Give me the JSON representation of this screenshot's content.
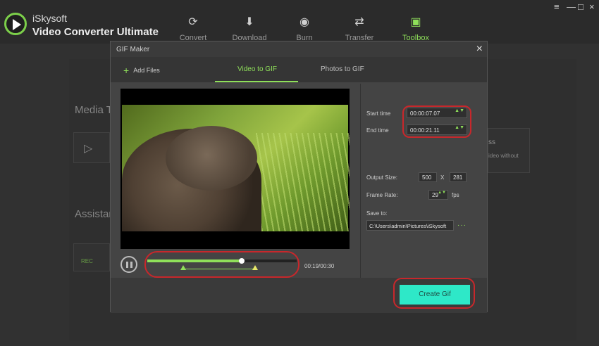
{
  "app": {
    "brand_line1": "iSkysoft",
    "brand_line2": "Video Converter Ultimate"
  },
  "nav": [
    {
      "label": "Convert",
      "icon": "convert-icon"
    },
    {
      "label": "Download",
      "icon": "download-icon"
    },
    {
      "label": "Burn",
      "icon": "burn-icon"
    },
    {
      "label": "Transfer",
      "icon": "transfer-icon"
    },
    {
      "label": "Toolbox",
      "icon": "toolbox-icon"
    }
  ],
  "window_controls": {
    "menu": "≡",
    "minimize": "—",
    "maximize": "□",
    "close": "×"
  },
  "background": {
    "media_tools_label": "Media To",
    "assistant_label": "Assistan",
    "card_text_1": "ss",
    "card_text_2": "ideo without",
    "rec_badge": "REC"
  },
  "modal": {
    "title": "GIF Maker",
    "close": "×",
    "add_files": "Add Files",
    "tabs": [
      "Video to GIF",
      "Photos to GIF"
    ],
    "active_tab": "Video to GIF",
    "start_time_label": "Start time",
    "start_time": "00:00:07.07",
    "end_time_label": "End time",
    "end_time": "00:00:21.11",
    "output_size_label": "Output Size:",
    "width": "500",
    "x_label": "X",
    "height": "281",
    "frame_rate_label": "Frame Rate:",
    "frame_rate": "29",
    "fps_label": "fps",
    "save_to_label": "Save to:",
    "save_path": "C:\\Users\\admin\\Pictures\\iSkysoft",
    "browse": "···",
    "playback_time": "00:19/00:30",
    "playback_progress": 0.63,
    "range_start": 0.24,
    "range_end": 0.72,
    "create_button": "Create Gif",
    "spinner": "▲▼"
  },
  "colors": {
    "accent": "#8fe05a",
    "create_button": "#2ee8c8",
    "highlight": "#c8272b"
  }
}
